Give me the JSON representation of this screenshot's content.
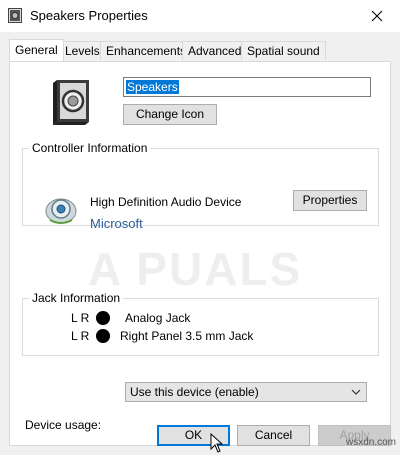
{
  "window": {
    "title": "Speakers Properties",
    "close_symbol": "✕"
  },
  "tabs": [
    {
      "label": "General",
      "active": true
    },
    {
      "label": "Levels",
      "active": false
    },
    {
      "label": "Enhancements",
      "active": false
    },
    {
      "label": "Advanced",
      "active": false
    },
    {
      "label": "Spatial sound",
      "active": false
    }
  ],
  "general": {
    "device_name_value": "Speakers",
    "change_icon_label": "Change Icon"
  },
  "controller": {
    "group_title": "Controller Information",
    "device_name": "High Definition Audio Device",
    "properties_label": "Properties",
    "manufacturer_link": "Microsoft"
  },
  "watermark": "A PUALS",
  "jack": {
    "group_title": "Jack Information",
    "rows": [
      {
        "channels": "L R",
        "label": "Analog Jack"
      },
      {
        "channels": "L R",
        "label": "Right Panel 3.5 mm Jack"
      }
    ]
  },
  "device_usage": {
    "label": "Device usage:",
    "selected": "Use this device (enable)"
  },
  "footer": {
    "ok_label": "OK",
    "cancel_label": "Cancel",
    "apply_label": "Apply",
    "site_mark": "wsxdn.com"
  },
  "colors": {
    "accent": "#0078d7",
    "link": "#2b5d9b",
    "panel_bg": "#ffffff",
    "dialog_bg": "#f0f0f0"
  }
}
